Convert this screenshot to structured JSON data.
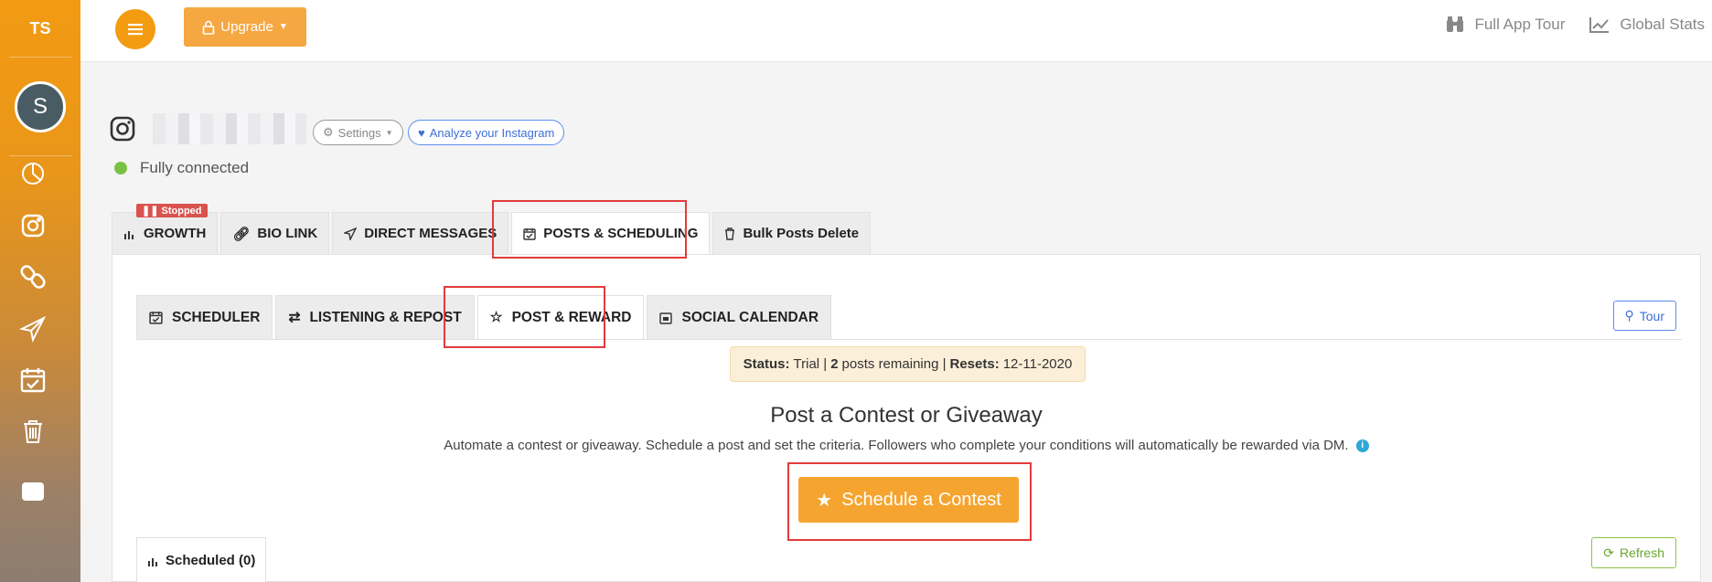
{
  "sidebar": {
    "initials": "TS",
    "avatar_letter": "S",
    "icons": [
      "chart-pie-icon",
      "instagram-icon",
      "link-icon",
      "send-icon",
      "calendar-check-icon",
      "trash-icon"
    ]
  },
  "topbar": {
    "upgrade_label": "Upgrade",
    "full_app_tour": "Full App Tour",
    "global_stats": "Global Stats"
  },
  "profile": {
    "settings_label": "Settings",
    "analyze_label": "Analyze your Instagram",
    "connection_status": "Fully connected"
  },
  "main_tabs": [
    {
      "label": "GROWTH",
      "badge": "Stopped"
    },
    {
      "label": "BIO LINK"
    },
    {
      "label": "DIRECT MESSAGES"
    },
    {
      "label": "POSTS & SCHEDULING"
    },
    {
      "label": "Bulk Posts Delete"
    }
  ],
  "sub_tabs": [
    {
      "label": "SCHEDULER"
    },
    {
      "label": "LISTENING & REPOST"
    },
    {
      "label": "POST & REWARD"
    },
    {
      "label": "SOCIAL CALENDAR"
    }
  ],
  "tour_label": "Tour",
  "status": {
    "status_key": "Status:",
    "status_value": "Trial |",
    "posts_count": "2",
    "posts_text": "posts remaining |",
    "resets_key": "Resets:",
    "resets_value": "12-11-2020"
  },
  "contest": {
    "title": "Post a Contest or Giveaway",
    "description": "Automate a contest or giveaway. Schedule a post and set the criteria. Followers who complete your conditions will automatically be rewarded via DM.",
    "button_label": "Schedule a Contest"
  },
  "scheduled_tab": "Scheduled (0)",
  "refresh_label": "Refresh",
  "colors": {
    "accent": "#f39c12",
    "highlight": "#e23b3b",
    "connected": "#7ac143"
  }
}
